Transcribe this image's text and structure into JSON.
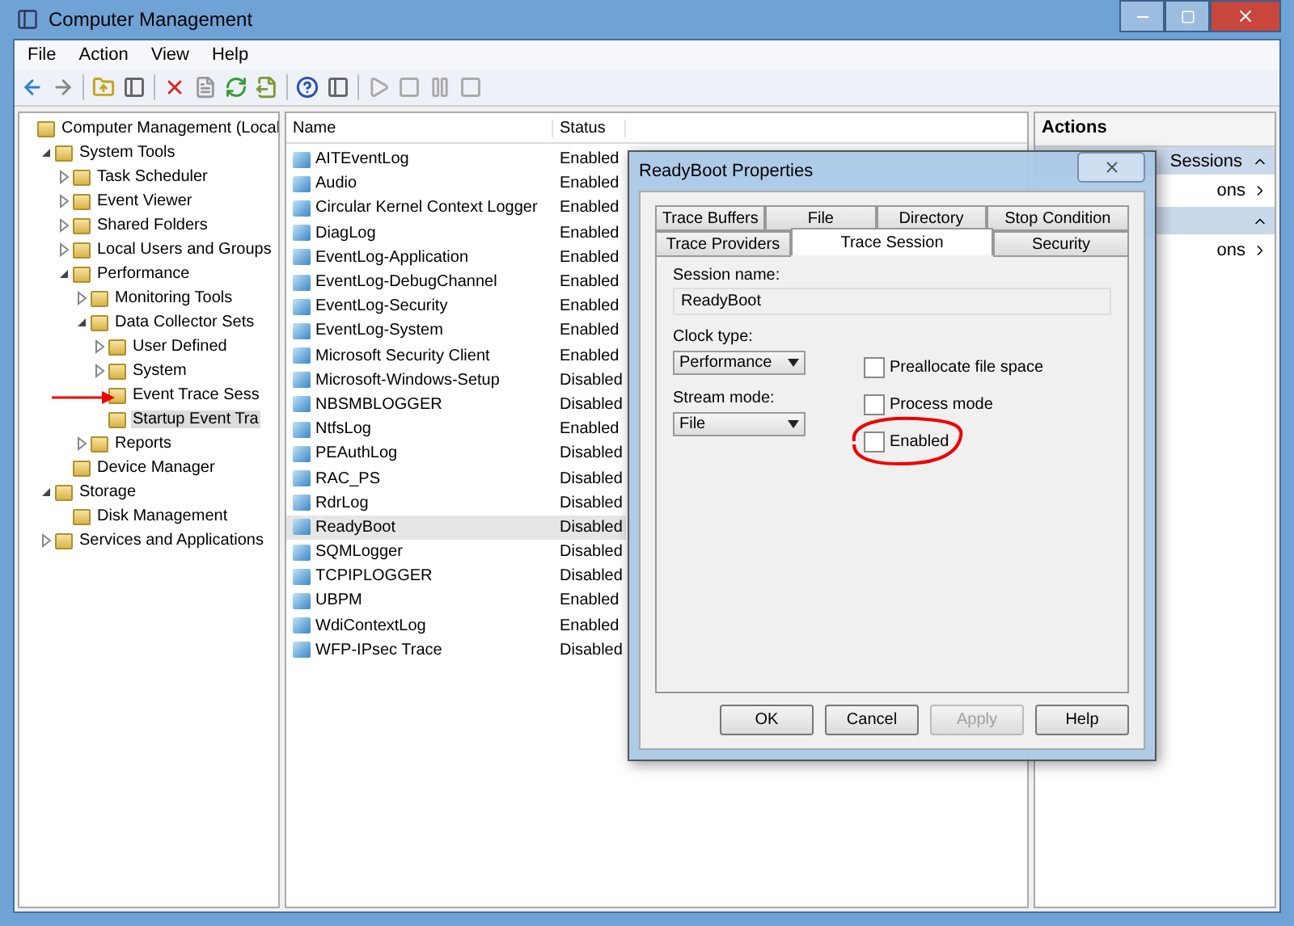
{
  "window": {
    "title": "Computer Management"
  },
  "menu": [
    "File",
    "Action",
    "View",
    "Help"
  ],
  "tree": [
    {
      "label": "Computer Management (Local",
      "selected": false,
      "children": [
        {
          "label": "System Tools",
          "expanded": true,
          "selected": false,
          "children": [
            {
              "label": "Task Scheduler",
              "expanded": false,
              "selected": false
            },
            {
              "label": "Event Viewer",
              "expanded": false,
              "selected": false
            },
            {
              "label": "Shared Folders",
              "expanded": false,
              "selected": false
            },
            {
              "label": "Local Users and Groups",
              "expanded": false,
              "selected": false
            },
            {
              "label": "Performance",
              "expanded": true,
              "selected": false,
              "children": [
                {
                  "label": "Monitoring Tools",
                  "expanded": false,
                  "selected": false
                },
                {
                  "label": "Data Collector Sets",
                  "expanded": true,
                  "selected": false,
                  "children": [
                    {
                      "label": "User Defined",
                      "expanded": false,
                      "selected": false
                    },
                    {
                      "label": "System",
                      "expanded": false,
                      "selected": false
                    },
                    {
                      "label": "Event Trace Sess",
                      "selected": false
                    },
                    {
                      "label": "Startup Event Tra",
                      "selected": true
                    }
                  ]
                },
                {
                  "label": "Reports",
                  "expanded": false,
                  "selected": false
                }
              ]
            },
            {
              "label": "Device Manager",
              "selected": false
            }
          ]
        },
        {
          "label": "Storage",
          "expanded": true,
          "selected": false,
          "children": [
            {
              "label": "Disk Management",
              "selected": false
            }
          ]
        },
        {
          "label": "Services and Applications",
          "expanded": false,
          "selected": false
        }
      ]
    }
  ],
  "table": {
    "columns": [
      "Name",
      "Status"
    ],
    "rows": [
      {
        "name": "AITEventLog",
        "status": "Enabled",
        "selected": false
      },
      {
        "name": "Audio",
        "status": "Enabled",
        "selected": false
      },
      {
        "name": "Circular Kernel Context Logger",
        "status": "Enabled",
        "selected": false
      },
      {
        "name": "DiagLog",
        "status": "Enabled",
        "selected": false
      },
      {
        "name": "EventLog-Application",
        "status": "Enabled",
        "selected": false
      },
      {
        "name": "EventLog-DebugChannel",
        "status": "Enabled",
        "selected": false
      },
      {
        "name": "EventLog-Security",
        "status": "Enabled",
        "selected": false
      },
      {
        "name": "EventLog-System",
        "status": "Enabled",
        "selected": false
      },
      {
        "name": "Microsoft Security Client",
        "status": "Enabled",
        "selected": false
      },
      {
        "name": "Microsoft-Windows-Setup",
        "status": "Disabled",
        "selected": false
      },
      {
        "name": "NBSMBLOGGER",
        "status": "Disabled",
        "selected": false
      },
      {
        "name": "NtfsLog",
        "status": "Enabled",
        "selected": false
      },
      {
        "name": "PEAuthLog",
        "status": "Disabled",
        "selected": false
      },
      {
        "name": "RAC_PS",
        "status": "Disabled",
        "selected": false
      },
      {
        "name": "RdrLog",
        "status": "Disabled",
        "selected": false
      },
      {
        "name": "ReadyBoot",
        "status": "Disabled",
        "selected": true
      },
      {
        "name": "SQMLogger",
        "status": "Disabled",
        "selected": false
      },
      {
        "name": "TCPIPLOGGER",
        "status": "Disabled",
        "selected": false
      },
      {
        "name": "UBPM",
        "status": "Enabled",
        "selected": false
      },
      {
        "name": "WdiContextLog",
        "status": "Enabled",
        "selected": false
      },
      {
        "name": "WFP-IPsec Trace",
        "status": "Disabled",
        "selected": false
      }
    ]
  },
  "actions": {
    "title": "Actions",
    "sections": [
      {
        "title": "Sessions",
        "items": [
          "ons"
        ]
      },
      {
        "items": [
          "ons"
        ]
      }
    ]
  },
  "dialog": {
    "title": "ReadyBoot Properties",
    "tab_rows": [
      [
        {
          "label": "Trace Buffers",
          "selected": false
        },
        {
          "label": "File",
          "selected": false
        },
        {
          "label": "Directory",
          "selected": false
        },
        {
          "label": "Stop Condition",
          "selected": false
        }
      ],
      [
        {
          "label": "Trace Providers",
          "selected": false
        },
        {
          "label": "Trace Session",
          "selected": true
        },
        {
          "label": "Security",
          "selected": false
        }
      ]
    ],
    "session_name": {
      "label": "Session name:",
      "value": "ReadyBoot"
    },
    "clock_type": {
      "label": "Clock type:",
      "value": "Performance"
    },
    "stream_mode": {
      "label": "Stream mode:",
      "value": "File"
    },
    "checkboxes": [
      {
        "label": "Preallocate file space",
        "checked": false,
        "circled": false
      },
      {
        "label": "Process mode",
        "checked": false,
        "circled": false
      },
      {
        "label": "Enabled",
        "checked": false,
        "circled": true
      }
    ],
    "buttons": [
      {
        "label": "OK",
        "disabled": false
      },
      {
        "label": "Cancel",
        "disabled": false
      },
      {
        "label": "Apply",
        "disabled": true
      },
      {
        "label": "Help",
        "disabled": false
      }
    ]
  }
}
